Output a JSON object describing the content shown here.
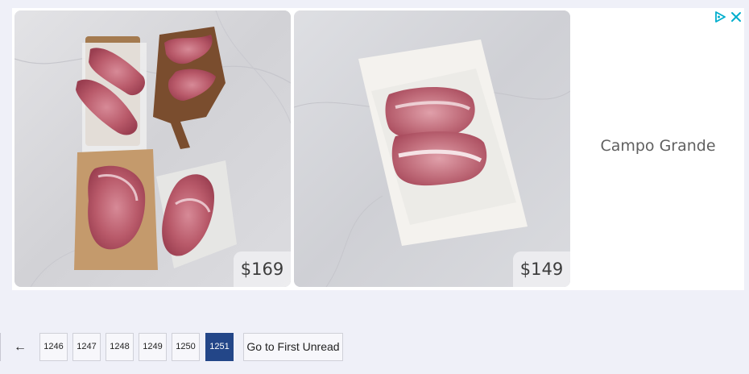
{
  "ad": {
    "products": [
      {
        "price": "$169",
        "image": "raw pork cuts on parchment and wooden boards, marble surface"
      },
      {
        "price": "$149",
        "image": "two raw pork steaks on printed paper, marble surface"
      }
    ],
    "advertiser": "Campo Grande",
    "adchoices_icon": "adchoices-triangle-icon",
    "close_icon": "close-x-icon",
    "accent_color": "#00aecd"
  },
  "pagination": {
    "prev_label": "←",
    "pages": [
      "1246",
      "1247",
      "1248",
      "1249",
      "1250",
      "1251"
    ],
    "current_page": "1251",
    "first_unread_label": "Go to First Unread",
    "current_color": "#234688"
  }
}
